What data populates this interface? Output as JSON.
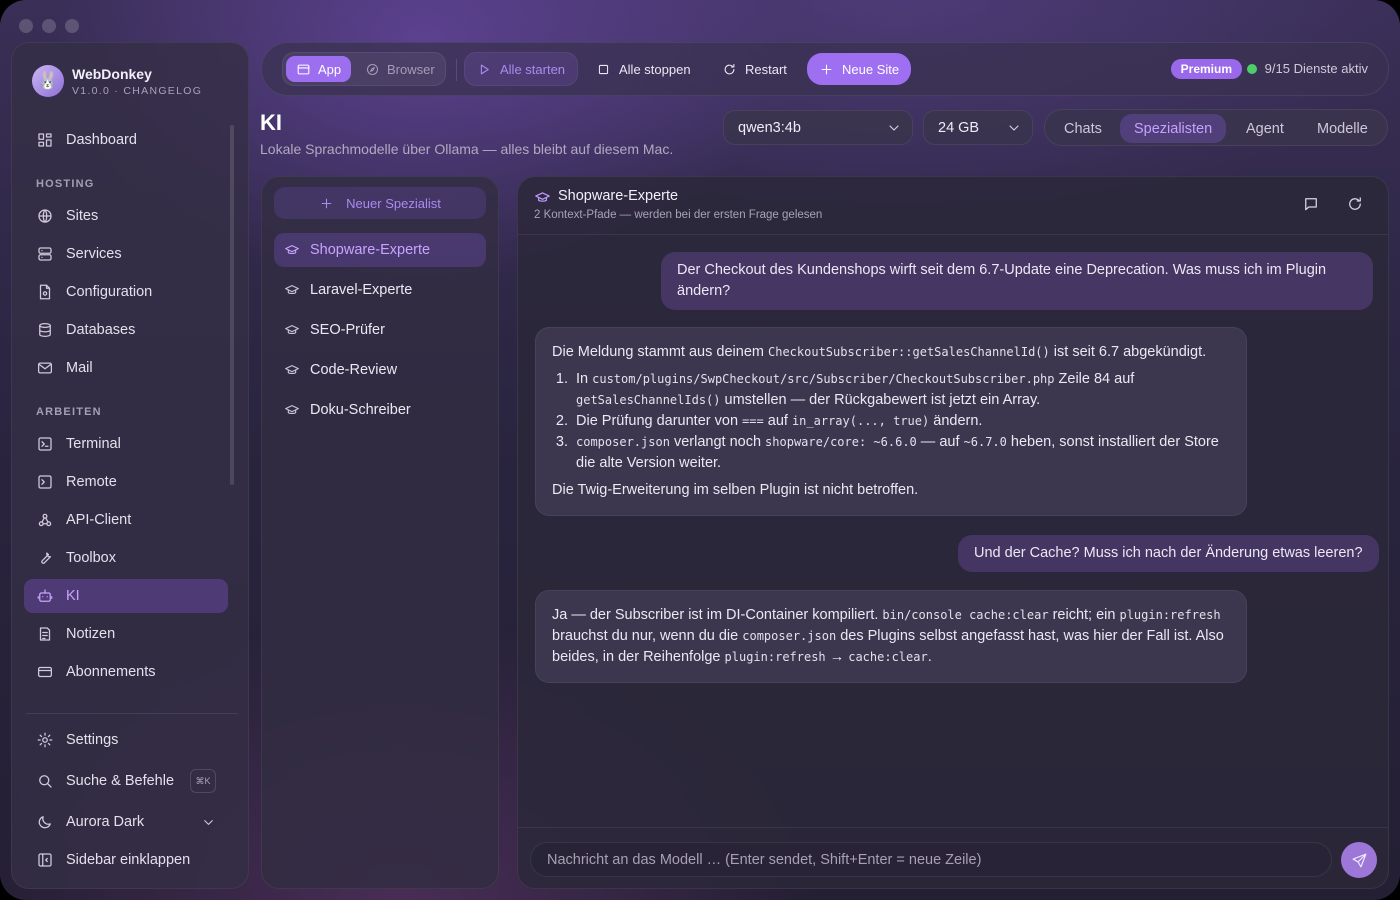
{
  "app": {
    "name": "WebDonkey",
    "version": "V1.0.0 · CHANGELOG"
  },
  "sidebar": {
    "top": [
      {
        "label": "Dashboard",
        "icon": "dashboard-icon"
      }
    ],
    "hosting_label": "HOSTING",
    "hosting": [
      {
        "label": "Sites",
        "icon": "globe-icon"
      },
      {
        "label": "Services",
        "icon": "server-icon"
      },
      {
        "label": "Configuration",
        "icon": "config-file-icon"
      },
      {
        "label": "Databases",
        "icon": "database-icon"
      },
      {
        "label": "Mail",
        "icon": "mail-icon"
      }
    ],
    "work_label": "ARBEITEN",
    "work": [
      {
        "label": "Terminal",
        "icon": "terminal-icon"
      },
      {
        "label": "Remote",
        "icon": "remote-terminal-icon"
      },
      {
        "label": "API-Client",
        "icon": "api-icon"
      },
      {
        "label": "Toolbox",
        "icon": "wrench-icon"
      },
      {
        "label": "KI",
        "icon": "robot-icon",
        "active": true
      },
      {
        "label": "Notizen",
        "icon": "note-icon"
      },
      {
        "label": "Abonnements",
        "icon": "credit-card-icon"
      }
    ],
    "bottom": {
      "settings": "Settings",
      "search": "Suche & Befehle",
      "search_kbd": "⌘K",
      "theme": "Aurora Dark",
      "collapse": "Sidebar einklappen"
    }
  },
  "topbar": {
    "mode_app": "App",
    "mode_browser": "Browser",
    "start_all": "Alle starten",
    "stop_all": "Alle stoppen",
    "restart": "Restart",
    "new_site": "Neue Site",
    "premium": "Premium",
    "services_status": "9/15 Dienste aktiv",
    "status_color": "#4ccf6a",
    "accent": "#9f6ff2"
  },
  "page": {
    "title": "KI",
    "subtitle": "Lokale Sprachmodelle über Ollama — alles bleibt auf diesem Mac.",
    "model": "qwen3:4b",
    "memory": "24 GB",
    "tabs": [
      "Chats",
      "Spezialisten",
      "Agent",
      "Modelle"
    ],
    "active_tab": "Spezialisten"
  },
  "specialists": {
    "new_label": "Neuer Spezialist",
    "items": [
      "Shopware-Experte",
      "Laravel-Experte",
      "SEO-Prüfer",
      "Code-Review",
      "Doku-Schreiber"
    ],
    "active": "Shopware-Experte"
  },
  "chat": {
    "title": "Shopware-Experte",
    "subtitle": "2 Kontext-Pfade — werden bei der ersten Frage gelesen",
    "messages": {
      "user1": "Der Checkout des Kundenshops wirft seit dem 6.7-Update eine Deprecation. Was muss ich im Plugin ändern?",
      "bot1": {
        "intro_a": "Die Meldung stammt aus deinem ",
        "intro_code": "CheckoutSubscriber::getSalesChannelId()",
        "intro_b": " ist seit 6.7 abgekündigt.",
        "s1_a": "In ",
        "s1_code1": "custom/plugins/SwpCheckout/src/Subscriber/CheckoutSubscriber.php",
        "s1_b": " Zeile 84 auf ",
        "s1_code2": "getSalesChannelIds()",
        "s1_c": " umstellen — der Rückgabewert ist jetzt ein Array.",
        "s2_a": "Die Prüfung darunter von ",
        "s2_code1": "===",
        "s2_b": " auf ",
        "s2_code2": "in_array(..., true)",
        "s2_c": " ändern.",
        "s3_code1": "composer.json",
        "s3_a": " verlangt noch ",
        "s3_code2": "shopware/core: ~6.6.0",
        "s3_b": " — auf ",
        "s3_code3": "~6.7.0",
        "s3_c": " heben, sonst installiert der Store die alte Version weiter.",
        "outro": "Die Twig-Erweiterung im selben Plugin ist nicht betroffen."
      },
      "user2": "Und der Cache? Muss ich nach der Änderung etwas leeren?",
      "bot2": {
        "a": "Ja — der Subscriber ist im DI-Container kompiliert. ",
        "code1": "bin/console cache:clear",
        "b": " reicht; ein ",
        "code2": "plugin:refresh",
        "c": " brauchst du nur, wenn du die ",
        "code3": "composer.json",
        "d": " des Plugins selbst angefasst hast, was hier der Fall ist. Also beides, in der Reihenfolge ",
        "code4": "plugin:refresh",
        "e": " → ",
        "code5": "cache:clear",
        "f": "."
      }
    },
    "input_placeholder": "Nachricht an das Modell … (Enter sendet, Shift+Enter = neue Zeile)"
  }
}
